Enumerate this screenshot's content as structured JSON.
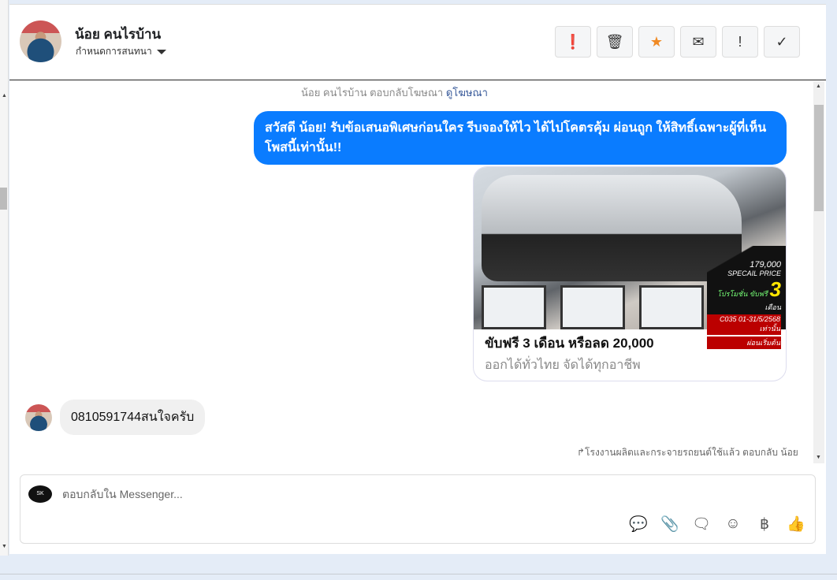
{
  "header": {
    "name": "น้อย คนไรบ้าน",
    "assign_label": "กำหนดการสนทนา",
    "tools": [
      {
        "icon": "alert-icon",
        "glyph": "❗"
      },
      {
        "icon": "trash-icon",
        "glyph": "🗑"
      },
      {
        "icon": "star-icon",
        "glyph": "★"
      },
      {
        "icon": "mail-icon",
        "glyph": "✉"
      },
      {
        "icon": "exclamation-icon",
        "glyph": "!"
      },
      {
        "icon": "check-icon",
        "glyph": "✓"
      }
    ]
  },
  "thread": {
    "notice_prefix": "น้อย คนไรบ้าน ตอบกลับโฆษณา",
    "notice_link": "ดูโฆษณา",
    "outgoing": "สวัสดี น้อย! รับข้อเสนอพิเศษก่อนใคร รีบจองให้ไว ได้ไปโคตรคุ้ม ผ่อนถูก ให้สิทธิ์เฉพาะผู้ที่เห็นโพสนี้เท่านั้น!!",
    "card": {
      "title": "ขับฟรี 3 เดือน หรือลด 20,000",
      "subtitle": "ออกได้ทั่วไทย จัดได้ทุกอาชีพ",
      "promo": {
        "price": "179,000",
        "special": "SPECAIL PRICE",
        "promo_label": "โปรโมชั่น ขับฟรี",
        "number": "3",
        "months": "เดือน",
        "code": "C035 01-31/5/2568 เท่านั้น",
        "installment": "ผ่อนเริ่มต้น"
      }
    },
    "incoming": "0810591744สนใจครับ",
    "reply_note": "↱โรงงานผลิตและกระจายรถยนต์ใช้แล้ว ตอบกลับ น้อย"
  },
  "composer": {
    "placeholder": "ตอบกลับใน Messenger...",
    "logo": "SK",
    "icons": [
      {
        "icon": "saved-reply-icon",
        "glyph": "💬"
      },
      {
        "icon": "attachment-icon",
        "glyph": "📎"
      },
      {
        "icon": "quick-reply-icon",
        "glyph": "🗨"
      },
      {
        "icon": "emoji-icon",
        "glyph": "☺"
      },
      {
        "icon": "baht-icon",
        "glyph": "฿"
      },
      {
        "icon": "like-icon",
        "glyph": "👍"
      }
    ]
  }
}
